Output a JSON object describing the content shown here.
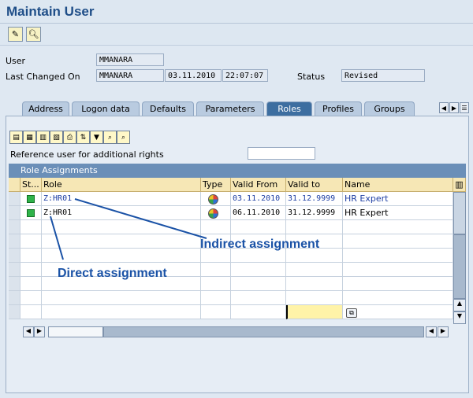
{
  "window": {
    "title": "Maintain User"
  },
  "toolbar": {
    "btn1_icon": "pencil-glasses-icon",
    "btn2_icon": "display-icon"
  },
  "header": {
    "user_label": "User",
    "user_value": "MMANARA",
    "last_changed_label": "Last Changed On",
    "last_changed_by": "MMANARA",
    "last_changed_date": "03.11.2010",
    "last_changed_time": "22:07:07",
    "status_label": "Status",
    "status_value": "Revised"
  },
  "tabs": [
    "Address",
    "Logon data",
    "Defaults",
    "Parameters",
    "Roles",
    "Profiles",
    "Groups"
  ],
  "active_tab": "Roles",
  "roles_panel": {
    "reference_user_label": "Reference user for additional rights",
    "reference_user_value": "",
    "grid_title": "Role Assignments",
    "columns": [
      "St...",
      "Role",
      "Type",
      "Valid From",
      "Valid to",
      "Name"
    ],
    "rows": [
      {
        "role": "Z:HR01",
        "valid_from": "03.11.2010",
        "valid_to": "31.12.9999",
        "name": "HR Expert",
        "indirect": true
      },
      {
        "role": "Z:HR01",
        "valid_from": "06.11.2010",
        "valid_to": "31.12.9999",
        "name": "HR Expert",
        "indirect": false
      }
    ]
  },
  "annotations": {
    "indirect": "Indirect assignment",
    "direct": "Direct assignment"
  },
  "colors": {
    "title": "#1f4e88",
    "active_tab": "#3d6ea0",
    "grid_header": "#6b8fb8",
    "annotation": "#1a52a6",
    "indirect_text": "#1d3ea3"
  }
}
